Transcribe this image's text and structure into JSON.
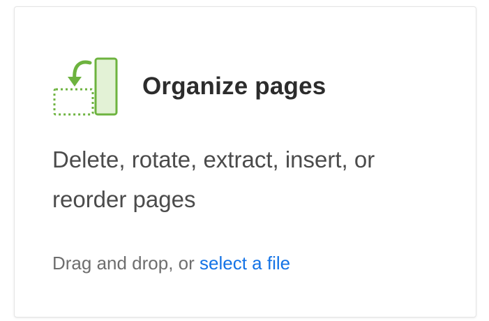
{
  "card": {
    "title": "Organize pages",
    "description": "Delete, rotate, extract, insert, or reorder pages",
    "drop_hint_prefix": "Drag and drop, or ",
    "select_file_link": "select a file",
    "icon": "organize-pages-icon"
  },
  "colors": {
    "link": "#1473e6",
    "icon_green": "#6db33f",
    "icon_fill": "#e3f2d6"
  }
}
